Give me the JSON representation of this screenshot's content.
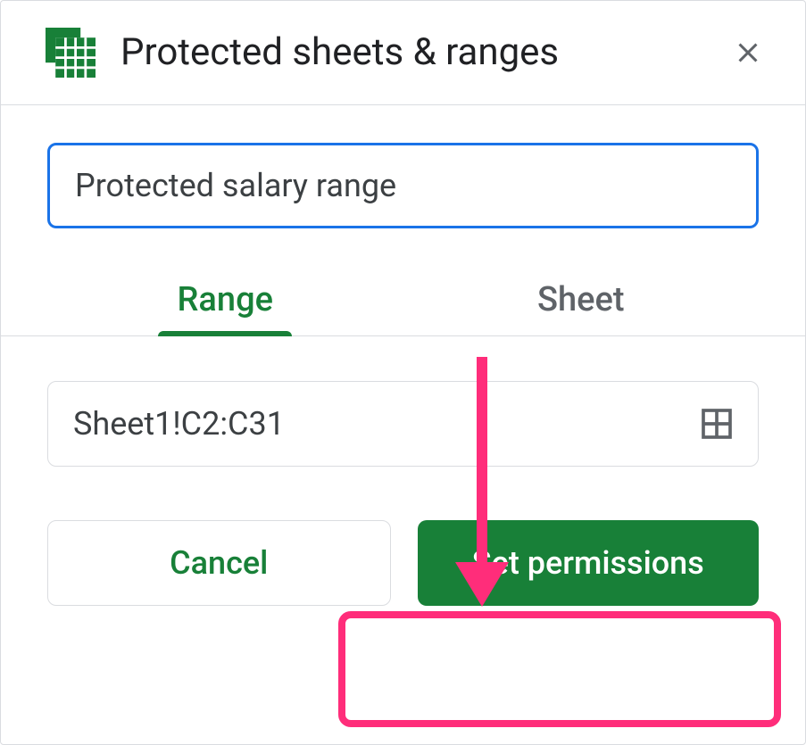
{
  "header": {
    "title": "Protected sheets & ranges"
  },
  "description": {
    "value": "Protected salary range"
  },
  "tabs": {
    "range": "Range",
    "sheet": "Sheet",
    "active": "range"
  },
  "range": {
    "value": "Sheet1!C2:C31"
  },
  "buttons": {
    "cancel": "Cancel",
    "set_permissions": "Set permissions"
  }
}
